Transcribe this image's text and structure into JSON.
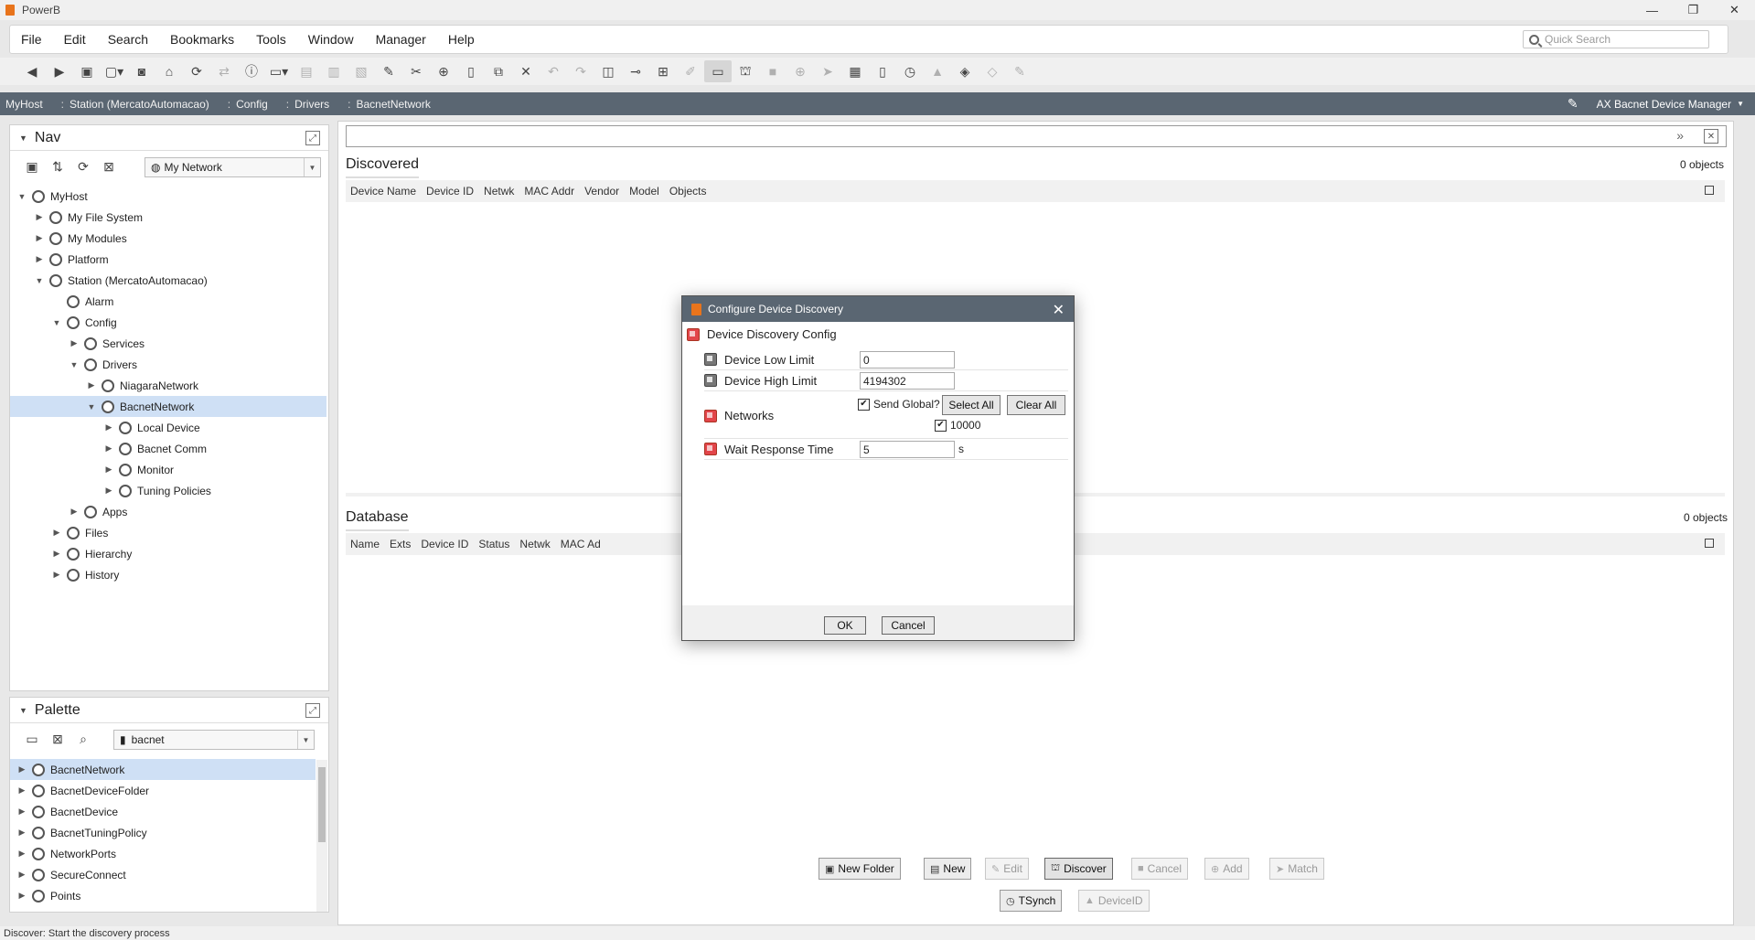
{
  "window": {
    "title": "PowerB",
    "controls": [
      "—",
      "❐",
      "✕"
    ]
  },
  "menu": {
    "items": [
      "File",
      "Edit",
      "Search",
      "Bookmarks",
      "Tools",
      "Window",
      "Manager",
      "Help"
    ]
  },
  "quick_search": {
    "placeholder": "Quick Search"
  },
  "breadcrumb": {
    "items": [
      "MyHost",
      "Station (MercatoAutomacao)",
      "Config",
      "Drivers",
      "BacnetNetwork"
    ]
  },
  "view_selector": {
    "label": "AX Bacnet Device Manager"
  },
  "nav": {
    "title": "Nav",
    "combo_value": "My Network",
    "tree": [
      {
        "label": "MyHost",
        "depth": 0,
        "expander": "open",
        "icon": "host-icon"
      },
      {
        "label": "My File System",
        "depth": 1,
        "expander": "closed",
        "icon": "host-icon"
      },
      {
        "label": "My Modules",
        "depth": 1,
        "expander": "closed",
        "icon": "modules-icon"
      },
      {
        "label": "Platform",
        "depth": 1,
        "expander": "closed",
        "icon": "platform-icon"
      },
      {
        "label": "Station (MercatoAutomacao)",
        "depth": 1,
        "expander": "open",
        "icon": "station-icon"
      },
      {
        "label": "Alarm",
        "depth": 2,
        "expander": "none",
        "icon": "bell-icon"
      },
      {
        "label": "Config",
        "depth": 2,
        "expander": "open",
        "icon": "host-icon"
      },
      {
        "label": "Services",
        "depth": 3,
        "expander": "closed",
        "icon": "gear-icon"
      },
      {
        "label": "Drivers",
        "depth": 3,
        "expander": "open",
        "icon": "gear-icon"
      },
      {
        "label": "NiagaraNetwork",
        "depth": 4,
        "expander": "closed",
        "icon": "network-icon"
      },
      {
        "label": "BacnetNetwork",
        "depth": 4,
        "expander": "open",
        "icon": "network-icon",
        "selected": true
      },
      {
        "label": "Local Device",
        "depth": 5,
        "expander": "closed",
        "icon": "device-icon"
      },
      {
        "label": "Bacnet Comm",
        "depth": 5,
        "expander": "closed",
        "icon": "comm-icon"
      },
      {
        "label": "Monitor",
        "depth": 5,
        "expander": "closed",
        "icon": "monitor-icon"
      },
      {
        "label": "Tuning Policies",
        "depth": 5,
        "expander": "closed",
        "icon": "tuning-icon"
      },
      {
        "label": "Apps",
        "depth": 3,
        "expander": "closed",
        "icon": "gear-icon"
      },
      {
        "label": "Files",
        "depth": 2,
        "expander": "closed",
        "icon": "host-icon"
      },
      {
        "label": "Hierarchy",
        "depth": 2,
        "expander": "closed",
        "icon": "hierarchy-icon"
      },
      {
        "label": "History",
        "depth": 2,
        "expander": "closed",
        "icon": "history-icon"
      }
    ]
  },
  "palette": {
    "title": "Palette",
    "combo_value": "bacnet",
    "items": [
      {
        "label": "BacnetNetwork",
        "icon": "network-icon",
        "selected": true
      },
      {
        "label": "BacnetDeviceFolder",
        "icon": "folder-icon"
      },
      {
        "label": "BacnetDevice",
        "icon": "device-icon"
      },
      {
        "label": "BacnetTuningPolicy",
        "icon": "tuning-icon"
      },
      {
        "label": "NetworkPorts",
        "icon": "host-icon"
      },
      {
        "label": "SecureConnect",
        "icon": "host-icon"
      },
      {
        "label": "Points",
        "icon": "host-icon"
      }
    ]
  },
  "discovered": {
    "title": "Discovered",
    "count": "0 objects",
    "columns": [
      "Device Name",
      "Device ID",
      "Netwk",
      "MAC Addr",
      "Vendor",
      "Model",
      "Objects"
    ]
  },
  "database": {
    "title": "Database",
    "count": "0 objects",
    "columns": [
      "Name",
      "Exts",
      "Device ID",
      "Status",
      "Netwk",
      "MAC Ad"
    ]
  },
  "bottom_buttons": {
    "row1": [
      {
        "label": "New Folder",
        "icon": "new-folder-icon",
        "enabled": true
      },
      {
        "label": "New",
        "icon": "new-icon",
        "enabled": true
      },
      {
        "label": "Edit",
        "icon": "edit-icon",
        "enabled": false
      },
      {
        "label": "Discover",
        "icon": "discover-icon",
        "enabled": true,
        "pressed": true
      },
      {
        "label": "Cancel",
        "icon": "stop-icon",
        "enabled": false
      },
      {
        "label": "Add",
        "icon": "add-icon",
        "enabled": false
      },
      {
        "label": "Match",
        "icon": "match-icon",
        "enabled": false
      }
    ],
    "row2": [
      {
        "label": "TSynch",
        "icon": "clock-icon",
        "enabled": true
      },
      {
        "label": "DeviceID",
        "icon": "warning-icon",
        "enabled": false
      }
    ]
  },
  "status_bar": {
    "text": "Discover: Start the discovery process"
  },
  "dialog": {
    "title": "Configure Device Discovery",
    "config_title": "Device Discovery Config",
    "fields": {
      "device_low_limit": {
        "label": "Device Low Limit",
        "value": "0"
      },
      "device_high_limit": {
        "label": "Device High Limit",
        "value": "4194302"
      },
      "networks": {
        "label": "Networks",
        "send_global_label": "Send Global?",
        "send_global_checked": true,
        "select_all": "Select All",
        "clear_all": "Clear All",
        "network_value": "10000",
        "network_checked": true
      },
      "wait_response_time": {
        "label": "Wait Response Time",
        "value": "5",
        "unit": "s"
      }
    },
    "ok_label": "OK",
    "cancel_label": "Cancel"
  },
  "colors": {
    "accent_bar": "#5a6672",
    "selection": "#cfe0f5",
    "alert_red": "#e2454a",
    "brand_orange": "#e8741c"
  }
}
